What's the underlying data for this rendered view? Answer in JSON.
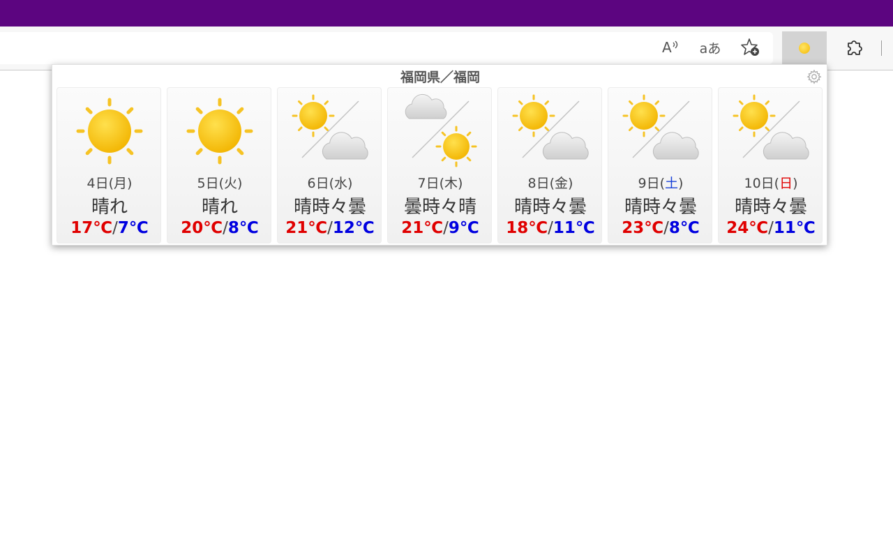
{
  "colors": {
    "titlebar": "#5c0580",
    "high_temp": "#e00000",
    "low_temp": "#0000e0",
    "saturday": "#1840d8",
    "sunday": "#e00000"
  },
  "toolbar": {
    "read_aloud_icon": "read-aloud-icon",
    "translate_label": "aあ",
    "favorite_icon": "add-favorite-icon",
    "weather_extension_icon": "sun-icon",
    "extensions_icon": "puzzle-icon"
  },
  "popup": {
    "location": "福岡県／福岡",
    "settings_icon": "gear-icon",
    "days": [
      {
        "day": "4日(",
        "weekday": "月",
        "close": ")",
        "weekday_type": "weekday",
        "weather": "晴れ",
        "icon": "sunny-icon",
        "high": "17℃",
        "low": "7℃"
      },
      {
        "day": "5日(",
        "weekday": "火",
        "close": ")",
        "weekday_type": "weekday",
        "weather": "晴れ",
        "icon": "sunny-icon",
        "high": "20℃",
        "low": "8℃"
      },
      {
        "day": "6日(",
        "weekday": "水",
        "close": ")",
        "weekday_type": "weekday",
        "weather": "晴時々曇",
        "icon": "sun-then-cloud-icon",
        "high": "21℃",
        "low": "12℃"
      },
      {
        "day": "7日(",
        "weekday": "木",
        "close": ")",
        "weekday_type": "weekday",
        "weather": "曇時々晴",
        "icon": "cloud-then-sun-icon",
        "high": "21℃",
        "low": "9℃"
      },
      {
        "day": "8日(",
        "weekday": "金",
        "close": ")",
        "weekday_type": "weekday",
        "weather": "晴時々曇",
        "icon": "sun-then-cloud-icon",
        "high": "18℃",
        "low": "11℃"
      },
      {
        "day": "9日(",
        "weekday": "土",
        "close": ")",
        "weekday_type": "saturday",
        "weather": "晴時々曇",
        "icon": "sun-then-cloud-icon",
        "high": "23℃",
        "low": "8℃"
      },
      {
        "day": "10日(",
        "weekday": "日",
        "close": ")",
        "weekday_type": "sunday",
        "weather": "晴時々曇",
        "icon": "sun-then-cloud-icon",
        "high": "24℃",
        "low": "11℃"
      }
    ]
  }
}
